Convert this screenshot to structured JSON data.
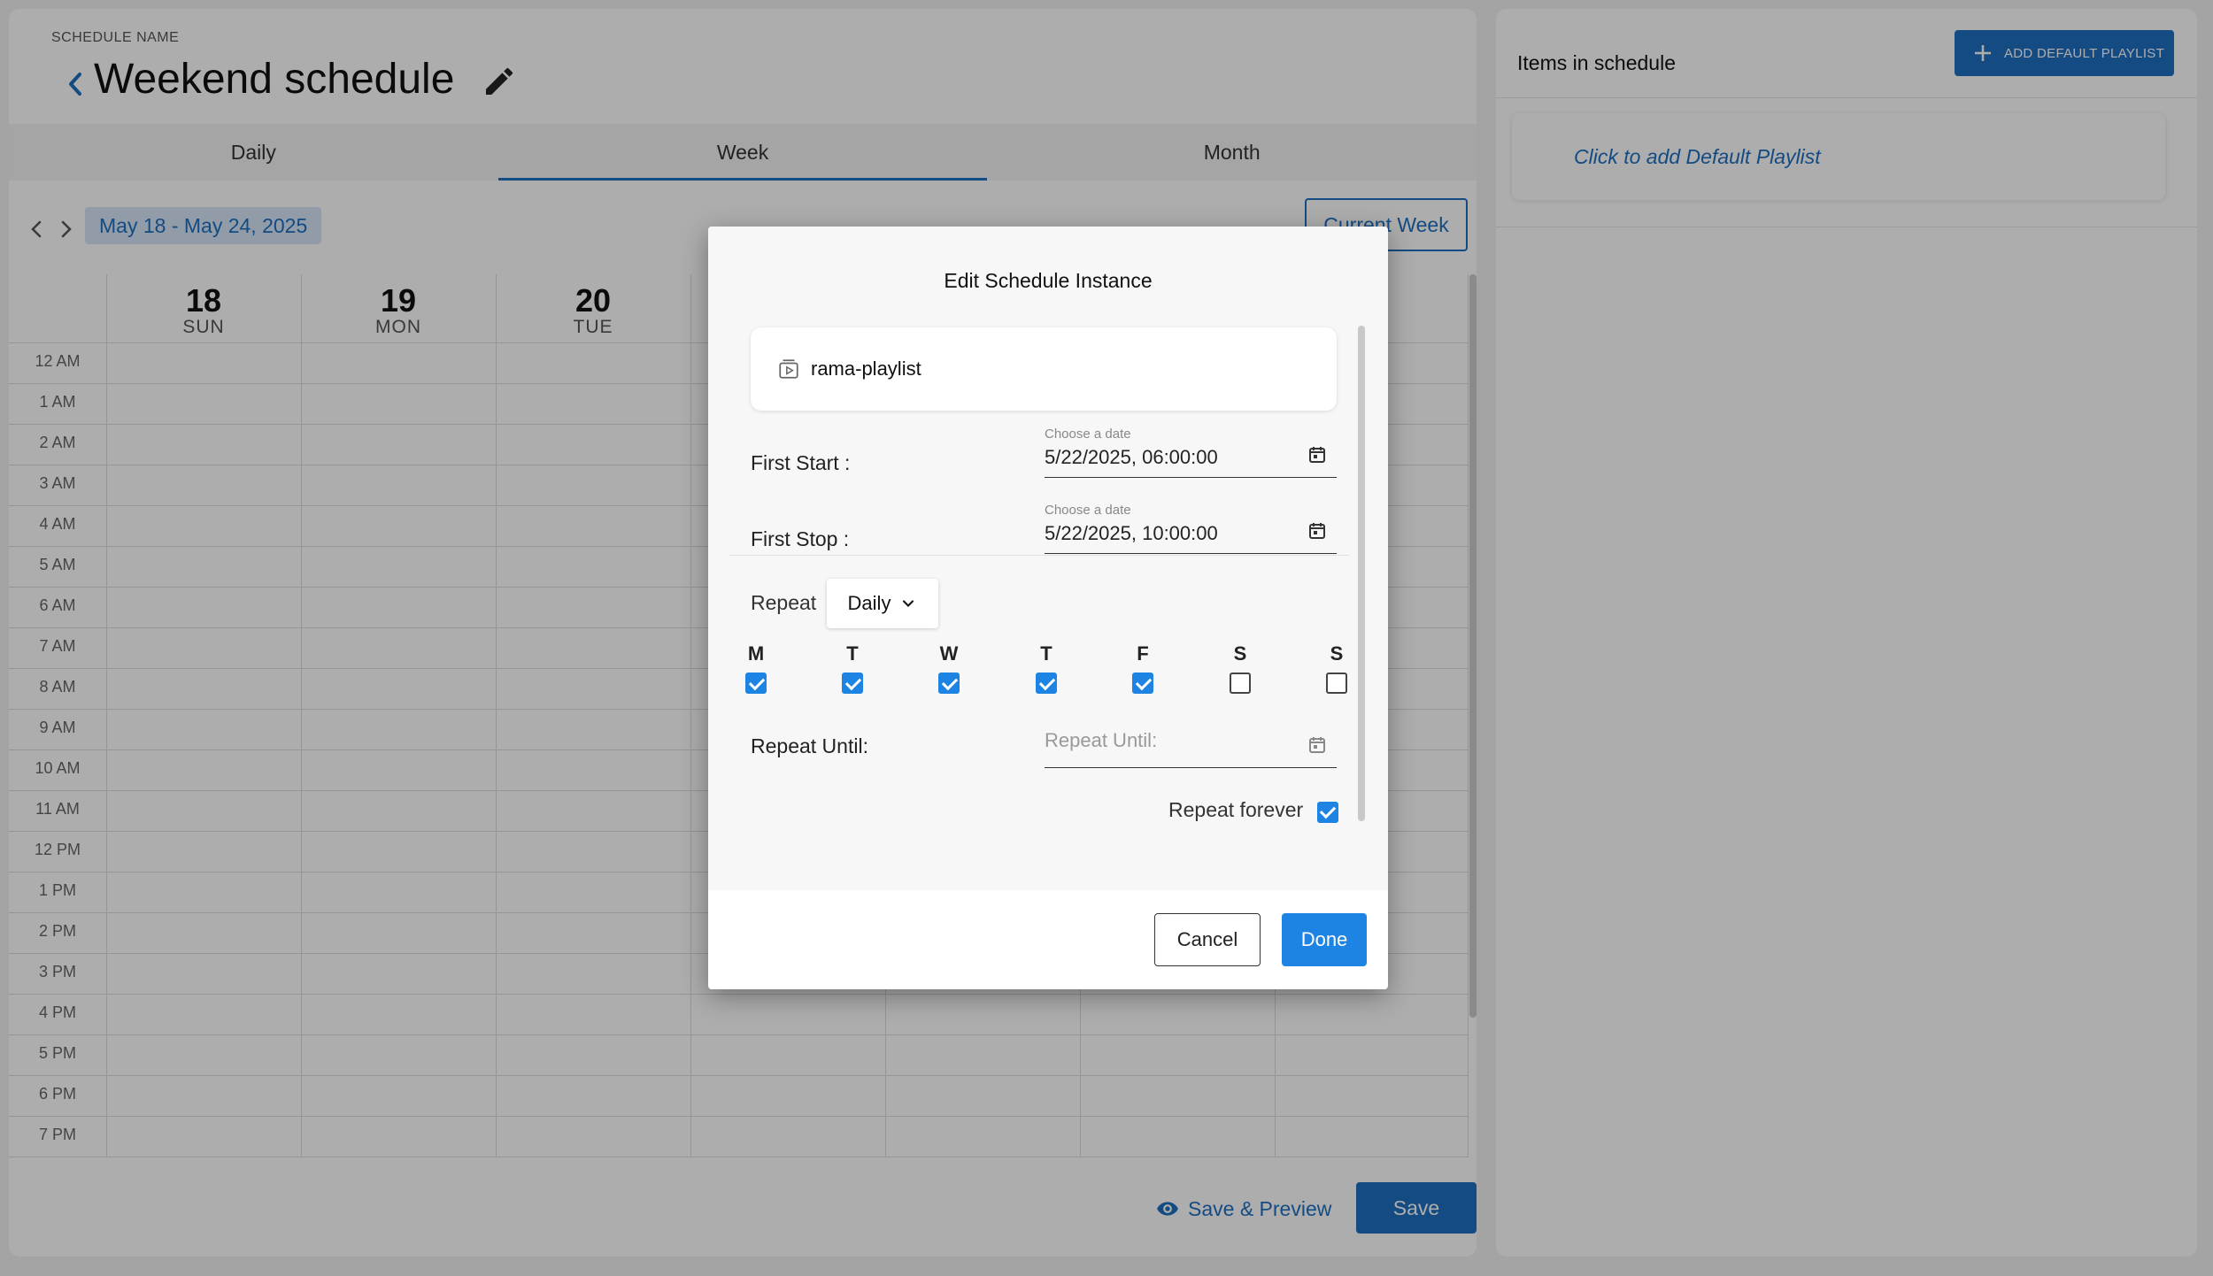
{
  "header": {
    "schedule_name_label": "SCHEDULE NAME",
    "title": "Weekend schedule"
  },
  "tabs": [
    {
      "label": "Daily"
    },
    {
      "label": "Week",
      "active": true
    },
    {
      "label": "Month"
    }
  ],
  "calendar_nav": {
    "range": "May 18 - May 24, 2025",
    "current_week_label": "Current Week"
  },
  "calendar": {
    "days": [
      {
        "num": "18",
        "name": "SUN"
      },
      {
        "num": "19",
        "name": "MON"
      },
      {
        "num": "20",
        "name": "TUE"
      }
    ],
    "hours": [
      "12 AM",
      "1 AM",
      "2 AM",
      "3 AM",
      "4 AM",
      "5 AM",
      "6 AM",
      "7 AM",
      "8 AM",
      "9 AM",
      "10 AM",
      "11 AM",
      "12 PM",
      "1 PM",
      "2 PM",
      "3 PM",
      "4 PM",
      "5 PM",
      "6 PM",
      "7 PM"
    ]
  },
  "footer": {
    "save_preview_label": "Save & Preview",
    "save_label": "Save"
  },
  "right_panel": {
    "title": "Items in schedule",
    "add_default_label": "ADD DEFAULT PLAYLIST",
    "add_card_text": "Click to add Default Playlist"
  },
  "modal": {
    "title": "Edit Schedule Instance",
    "playlist_name": "rama-playlist",
    "first_start": {
      "label": "First Start :",
      "hint": "Choose a date",
      "value": "5/22/2025, 06:00:00"
    },
    "first_stop": {
      "label": "First Stop :",
      "hint": "Choose a date",
      "value": "5/22/2025, 10:00:00"
    },
    "repeat_label": "Repeat",
    "repeat_value": "Daily",
    "weekdays": [
      {
        "letter": "M",
        "checked": true
      },
      {
        "letter": "T",
        "checked": true
      },
      {
        "letter": "W",
        "checked": true
      },
      {
        "letter": "T",
        "checked": true
      },
      {
        "letter": "F",
        "checked": true
      },
      {
        "letter": "S",
        "checked": false
      },
      {
        "letter": "S",
        "checked": false
      }
    ],
    "repeat_until_label": "Repeat Until:",
    "repeat_until_placeholder": "Repeat Until:",
    "repeat_forever_label": "Repeat forever",
    "repeat_forever_checked": true,
    "cancel_label": "Cancel",
    "done_label": "Done"
  },
  "colors": {
    "accent": "#1e6fc0",
    "checkbox": "#1e84e4"
  }
}
